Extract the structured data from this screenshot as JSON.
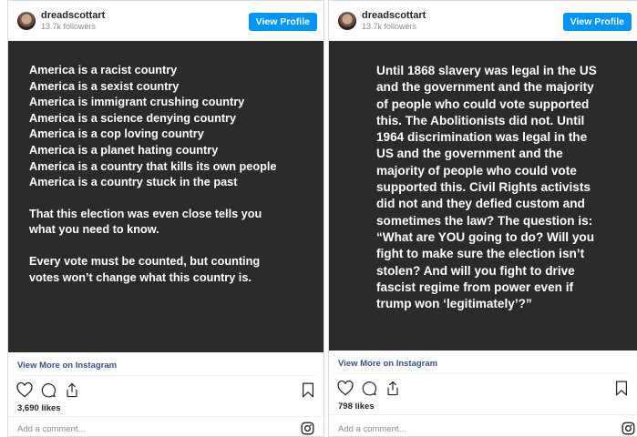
{
  "posts": [
    {
      "username": "dreadscottart",
      "followers": "13.7k followers",
      "view_profile": "View Profile",
      "image_lines": [
        "America is a racist country",
        "America is a sexist country",
        "America is immigrant crushing country",
        "America is a science denying country",
        "America is a cop loving country",
        "America is a planet hating country",
        "America is a country that kills its own people",
        "America is a country stuck in the past"
      ],
      "image_para2": [
        "That this election was even close tells you",
        "what you need to know."
      ],
      "image_para3": [
        "Every vote must be counted, but counting",
        "votes won’t change what this country is."
      ],
      "view_more": "View More on Instagram",
      "likes": "3,690 likes",
      "comment_placeholder": "Add a comment..."
    },
    {
      "username": "dreadscottart",
      "followers": "13.7k followers",
      "view_profile": "View Profile",
      "image_lines": [
        "Until 1868 slavery was legal in the US",
        "and the government and the majority",
        "of people who could vote supported",
        "this. The Abolitionists did not. Until",
        "1964 discrimination was legal in the",
        "US and the government and the",
        "majority of people who could vote",
        "supported this. Civil Rights activists",
        "did not and they defied custom and",
        "sometimes the law?  The question is:",
        "“What are YOU going to do? Will you",
        "fight to make sure the election isn’t",
        "stolen? And will you fight to drive",
        "fascist regime from power even if",
        "trump won ‘legitimately’?”"
      ],
      "view_more": "View More on Instagram",
      "likes": "798 likes",
      "comment_placeholder": "Add a comment..."
    }
  ],
  "icons": {
    "like": "heart-icon",
    "comment": "comment-icon",
    "share": "share-icon",
    "save": "bookmark-icon",
    "brand": "instagram-icon"
  },
  "colors": {
    "button_blue": "#0095f6",
    "link_blue": "#385185",
    "post_bg": "#2b2b2b"
  }
}
